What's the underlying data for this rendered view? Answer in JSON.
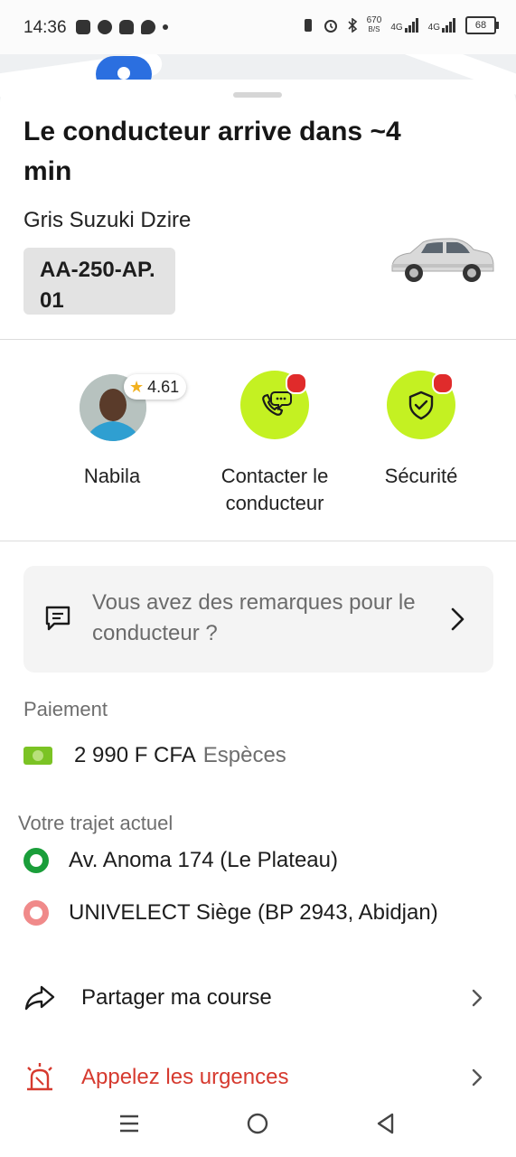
{
  "status_bar": {
    "time": "14:36",
    "net_speed_top": "670",
    "net_speed_bottom": "B/S",
    "signal1": "4G",
    "signal2": "4G",
    "battery": "68"
  },
  "trip": {
    "title": "Le conducteur arrive dans ~4 min",
    "car_description": "Gris Suzuki Dzire",
    "plate": "AA-250-AP. 01"
  },
  "driver": {
    "name": "Nabila",
    "rating": "4.61"
  },
  "actions": {
    "contact_label": "Contacter le conducteur",
    "safety_label": "Sécurité"
  },
  "remarks": {
    "prompt": "Vous avez des remarques pour le conducteur ?"
  },
  "payment": {
    "section_label": "Paiement",
    "amount": "2 990 F CFA",
    "method": "Espèces"
  },
  "route": {
    "section_label": "Votre trajet actuel",
    "pickup": "Av. Anoma 174 (Le Plateau)",
    "destination": "UNIVELECT Siège (BP 2943, Abidjan)"
  },
  "menu": {
    "share_label": "Partager ma course",
    "emergency_label": "Appelez les urgences"
  },
  "colors": {
    "accent_green": "#c4f122",
    "notification_red": "#e02b2b",
    "emergency_red": "#d63a2f",
    "pickup_green": "#1a9e3a",
    "destination_pink": "#f08a8a"
  }
}
